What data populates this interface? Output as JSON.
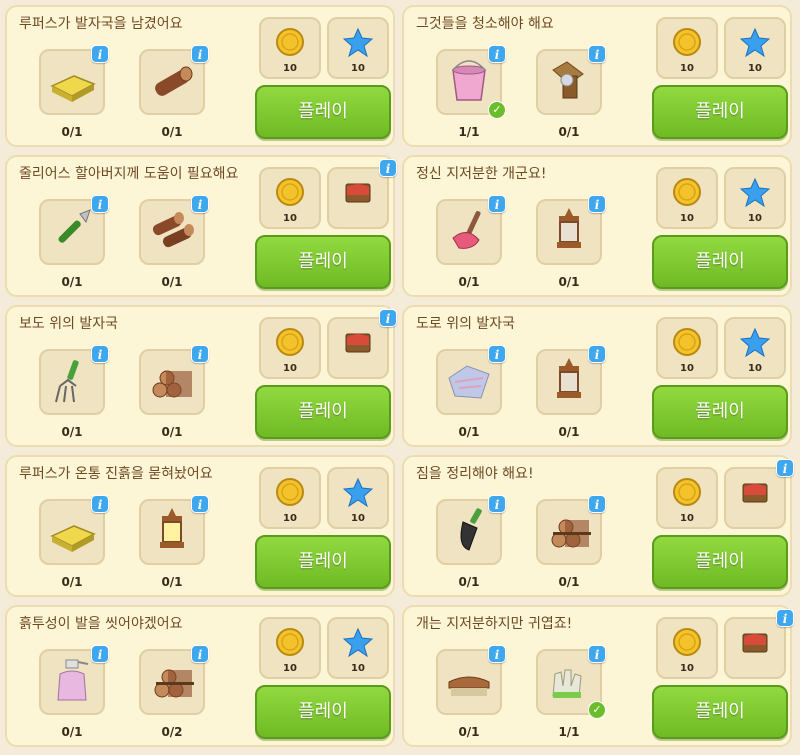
{
  "play_label": "플레이",
  "cards": [
    {
      "title": "루퍼스가 발자국을 남겼어요",
      "items": [
        {
          "icon": "sponge-icon",
          "count": "0/1",
          "done": false
        },
        {
          "icon": "log-icon",
          "count": "0/1",
          "done": false
        }
      ],
      "rewards": [
        {
          "icon": "gold-coin-icon",
          "count": "10"
        },
        {
          "icon": "blue-star-icon",
          "count": "10"
        }
      ]
    },
    {
      "title": "그것들을 청소해야 해요",
      "items": [
        {
          "icon": "bucket-icon",
          "count": "1/1",
          "done": true
        },
        {
          "icon": "door-knob-icon",
          "count": "0/1",
          "done": false
        }
      ],
      "rewards": [
        {
          "icon": "gold-coin-icon",
          "count": "10"
        },
        {
          "icon": "blue-star-icon",
          "count": "10"
        }
      ]
    },
    {
      "title": "줄리어스 할아버지께 도움이 필요해요",
      "items": [
        {
          "icon": "garden-shears-icon",
          "count": "0/1",
          "done": false
        },
        {
          "icon": "log-pair-icon",
          "count": "0/1",
          "done": false
        }
      ],
      "rewards": [
        {
          "icon": "gold-coin-icon",
          "count": "10"
        },
        {
          "icon": "red-cloth-box-icon",
          "count": ""
        }
      ]
    },
    {
      "title": "정신 지저분한 개군요!",
      "items": [
        {
          "icon": "plunger-icon",
          "count": "0/1",
          "done": false
        },
        {
          "icon": "lantern-icon",
          "count": "0/1",
          "done": false
        }
      ],
      "rewards": [
        {
          "icon": "gold-coin-icon",
          "count": "10"
        },
        {
          "icon": "blue-star-icon",
          "count": "10"
        }
      ]
    },
    {
      "title": "보도 위의 발자국",
      "items": [
        {
          "icon": "hand-fork-icon",
          "count": "0/1",
          "done": false
        },
        {
          "icon": "log-pile-icon",
          "count": "0/1",
          "done": false
        }
      ],
      "rewards": [
        {
          "icon": "gold-coin-icon",
          "count": "10"
        },
        {
          "icon": "red-cloth-box-icon",
          "count": ""
        }
      ]
    },
    {
      "title": "도로 위의 발자국",
      "items": [
        {
          "icon": "cloth-rag-icon",
          "count": "0/1",
          "done": false
        },
        {
          "icon": "lantern-icon",
          "count": "0/1",
          "done": false
        }
      ],
      "rewards": [
        {
          "icon": "gold-coin-icon",
          "count": "10"
        },
        {
          "icon": "blue-star-icon",
          "count": "10"
        }
      ]
    },
    {
      "title": "루퍼스가 온통 진흙을 묻혀놨어요",
      "items": [
        {
          "icon": "sponge-icon",
          "count": "0/1",
          "done": false
        },
        {
          "icon": "lit-lantern-icon",
          "count": "0/1",
          "done": false
        }
      ],
      "rewards": [
        {
          "icon": "gold-coin-icon",
          "count": "10"
        },
        {
          "icon": "blue-star-icon",
          "count": "10"
        }
      ]
    },
    {
      "title": "짐을 정리해야 해요!",
      "items": [
        {
          "icon": "trowel-icon",
          "count": "0/1",
          "done": false
        },
        {
          "icon": "tied-logs-icon",
          "count": "0/1",
          "done": false
        }
      ],
      "rewards": [
        {
          "icon": "gold-coin-icon",
          "count": "10"
        },
        {
          "icon": "red-cloth-box-icon",
          "count": ""
        }
      ]
    },
    {
      "title": "흙투성이 발을 씻어야겠어요",
      "items": [
        {
          "icon": "spray-bottle-icon",
          "count": "0/1",
          "done": false
        },
        {
          "icon": "tied-logs-icon",
          "count": "0/2",
          "done": false
        }
      ],
      "rewards": [
        {
          "icon": "gold-coin-icon",
          "count": "10"
        },
        {
          "icon": "blue-star-icon",
          "count": "10"
        }
      ]
    },
    {
      "title": "개는 지저분하지만 귀엽죠!",
      "items": [
        {
          "icon": "scrub-brush-icon",
          "count": "0/1",
          "done": false
        },
        {
          "icon": "gloves-icon",
          "count": "1/1",
          "done": true
        }
      ],
      "rewards": [
        {
          "icon": "gold-coin-icon",
          "count": "10"
        },
        {
          "icon": "red-cloth-box-icon",
          "count": ""
        }
      ]
    }
  ]
}
